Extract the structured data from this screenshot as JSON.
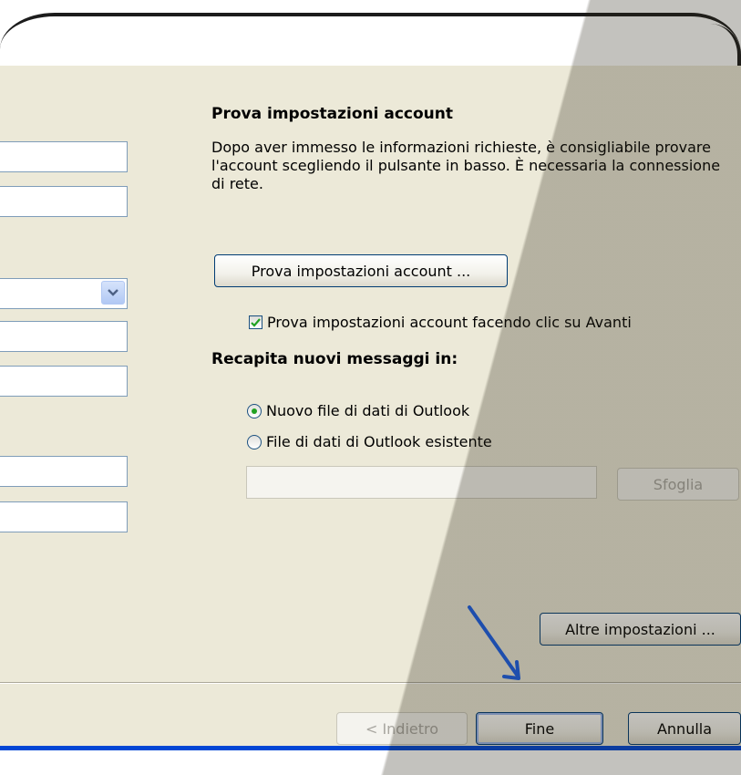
{
  "section_title": "Prova impostazioni account",
  "description": "Dopo aver immesso le informazioni richieste, è consigliabile provare l'account scegliendo il pulsante in basso. È necessaria la connessione di rete.",
  "test_button_label": "Prova impostazioni account ...",
  "test_on_next_label": "Prova impostazioni account facendo clic su Avanti",
  "test_on_next_checked": true,
  "deliver_title": "Recapita nuovi messaggi in:",
  "radio_new_label": "Nuovo file di dati di Outlook",
  "radio_existing_label": "File di dati di Outlook esistente",
  "selected_radio": "new",
  "existing_file_path": "",
  "browse_label": "Sfoglia",
  "more_settings_label": "Altre impostazioni ...",
  "footer": {
    "back_label": "< Indietro",
    "finish_label": "Fine",
    "cancel_label": "Annulla"
  },
  "annotation_arrow_color": "#1a5fe8"
}
